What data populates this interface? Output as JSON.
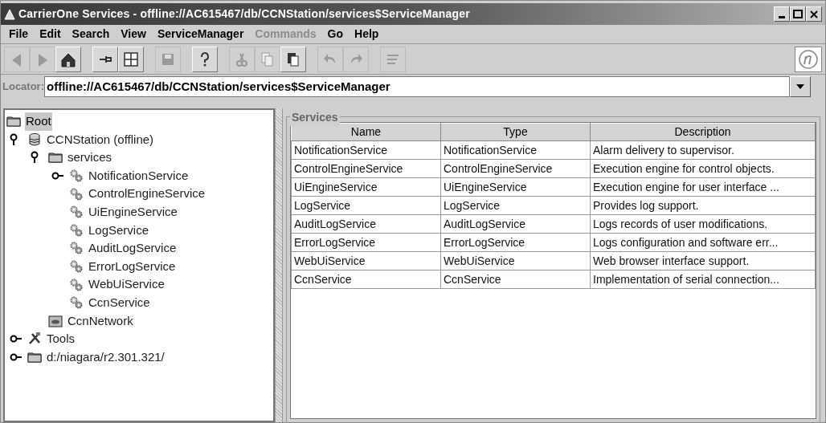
{
  "window": {
    "title": "CarrierOne Services - offline://AC615467/db/CCNStation/services$ServiceManager"
  },
  "menu": [
    {
      "label": "File",
      "disabled": false
    },
    {
      "label": "Edit",
      "disabled": false
    },
    {
      "label": "Search",
      "disabled": false
    },
    {
      "label": "View",
      "disabled": false
    },
    {
      "label": "ServiceManager",
      "disabled": false
    },
    {
      "label": "Commands",
      "disabled": true
    },
    {
      "label": "Go",
      "disabled": false
    },
    {
      "label": "Help",
      "disabled": false
    }
  ],
  "toolbar": [
    {
      "kind": "back",
      "disabled": true,
      "gap_before": false
    },
    {
      "kind": "forward",
      "disabled": true,
      "gap_before": false
    },
    {
      "kind": "home",
      "disabled": false,
      "gap_before": false
    },
    {
      "kind": "pin",
      "disabled": false,
      "gap_before": true
    },
    {
      "kind": "grid",
      "disabled": false,
      "gap_before": false
    },
    {
      "kind": "save",
      "disabled": true,
      "gap_before": true
    },
    {
      "kind": "help",
      "disabled": false,
      "gap_before": true
    },
    {
      "kind": "cut",
      "disabled": true,
      "gap_before": true
    },
    {
      "kind": "copy",
      "disabled": true,
      "gap_before": false
    },
    {
      "kind": "paste",
      "disabled": false,
      "gap_before": false
    },
    {
      "kind": "undo",
      "disabled": true,
      "gap_before": true
    },
    {
      "kind": "redo",
      "disabled": true,
      "gap_before": false
    },
    {
      "kind": "list",
      "disabled": true,
      "gap_before": true
    }
  ],
  "locator": {
    "label": "Locator:",
    "value": "offline://AC615467/db/CCNStation/services$ServiceManager"
  },
  "tree": [
    {
      "label": "Root",
      "kind": "folder",
      "selected": true,
      "children": [
        {
          "label": "CCNStation (offline)",
          "kind": "database",
          "selected": false,
          "expanded": true,
          "children": [
            {
              "label": "services",
              "kind": "folder",
              "selected": false,
              "expanded": true,
              "children": [
                {
                  "label": "NotificationService",
                  "kind": "service",
                  "selected": false,
                  "expanded": false
                },
                {
                  "label": "ControlEngineService",
                  "kind": "service",
                  "selected": false
                },
                {
                  "label": "UiEngineService",
                  "kind": "service",
                  "selected": false
                },
                {
                  "label": "LogService",
                  "kind": "service",
                  "selected": false
                },
                {
                  "label": "AuditLogService",
                  "kind": "service",
                  "selected": false
                },
                {
                  "label": "ErrorLogService",
                  "kind": "service",
                  "selected": false
                },
                {
                  "label": "WebUiService",
                  "kind": "service",
                  "selected": false
                },
                {
                  "label": "CcnService",
                  "kind": "service",
                  "selected": false
                }
              ]
            },
            {
              "label": "CcnNetwork",
              "kind": "network",
              "selected": false
            }
          ]
        },
        {
          "label": "Tools",
          "kind": "tools",
          "selected": false,
          "expanded": false
        },
        {
          "label": "d:/niagara/r2.301.321/",
          "kind": "folder",
          "selected": false,
          "expanded": false
        }
      ]
    }
  ],
  "services": {
    "title": "Services",
    "columns": [
      "Name",
      "Type",
      "Description"
    ],
    "rows": [
      [
        "NotificationService",
        "NotificationService",
        "Alarm delivery to supervisor."
      ],
      [
        "ControlEngineService",
        "ControlEngineService",
        "Execution engine for control objects."
      ],
      [
        "UiEngineService",
        "UiEngineService",
        "Execution engine for user interface ..."
      ],
      [
        "LogService",
        "LogService",
        "Provides log support."
      ],
      [
        "AuditLogService",
        "AuditLogService",
        "Logs records of user modifications."
      ],
      [
        "ErrorLogService",
        "ErrorLogService",
        "Logs configuration and software err..."
      ],
      [
        "WebUiService",
        "WebUiService",
        "Web browser interface support."
      ],
      [
        "CcnService",
        "CcnService",
        "Implementation of serial connection..."
      ]
    ]
  }
}
